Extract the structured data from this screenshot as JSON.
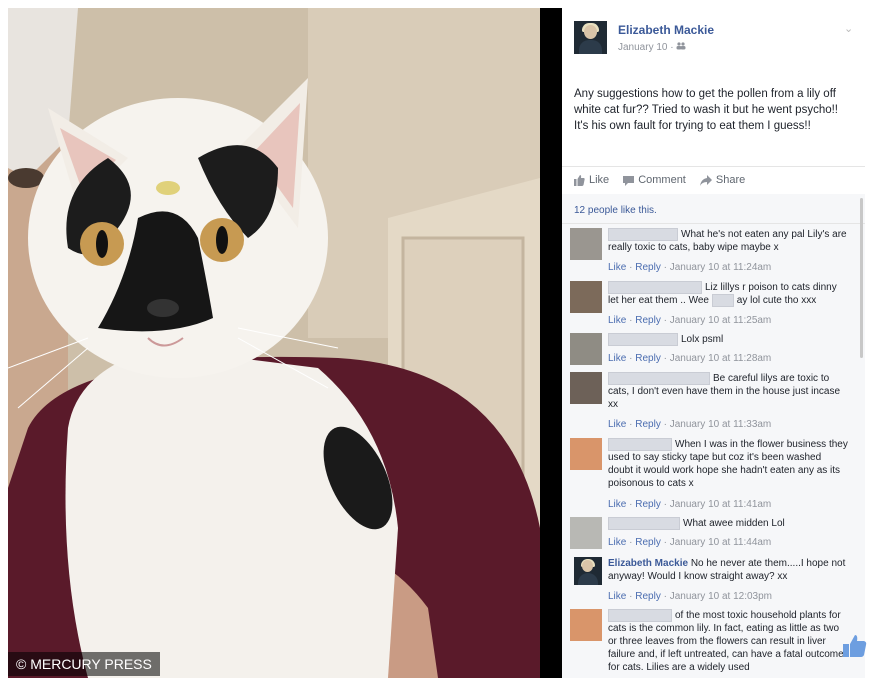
{
  "watermark": "© MERCURY PRESS",
  "post": {
    "author": "Elizabeth Mackie",
    "date": "January 10 · ",
    "audience_icon": "friends-icon",
    "text": "Any suggestions how to get the pollen from a lily off white cat fur?? Tried to wash it but he went psycho!! It's his own fault for trying to eat them I guess!!"
  },
  "actions": {
    "like": "Like",
    "comment": "Comment",
    "share": "Share"
  },
  "likes_count": "12 people like this.",
  "comments": [
    {
      "text": "What he's not eaten any pal Lily's are really toxic to cats, baby wipe maybe x",
      "meta": {
        "like": "Like",
        "reply": "Reply",
        "time": "January 10 at 11:24am"
      },
      "avatar_color": "#9a9690"
    },
    {
      "text": "Liz lillys r poison to cats dinny let her eat them .. Wee",
      "text2": "ay lol cute tho xxx",
      "meta": {
        "like": "Like",
        "reply": "Reply",
        "time": "January 10 at 11:25am"
      },
      "avatar_color": "#7c6a5a"
    },
    {
      "text": "Lolx psml",
      "meta": {
        "like": "Like",
        "reply": "Reply",
        "time": "January 10 at 11:28am"
      },
      "avatar_color": "#8f8c84"
    },
    {
      "text": "Be careful lilys are toxic to cats, I don't even have them in the house just incase xx",
      "meta": {
        "like": "Like",
        "reply": "Reply",
        "time": "January 10 at 11:33am"
      },
      "avatar_color": "#6d6158"
    },
    {
      "text": "When I was in the flower business they used to say sticky tape but coz it's been washed doubt it would work hope she hadn't eaten any as its poisonous to cats x",
      "meta": {
        "like": "Like",
        "reply": "Reply",
        "time": "January 10 at 11:41am"
      },
      "avatar_color": "#d9956a"
    },
    {
      "text": "What awee midden Lol",
      "meta": {
        "like": "Like",
        "reply": "Reply",
        "time": "January 10 at 11:44am"
      },
      "avatar_color": "#b8b8b4"
    },
    {
      "name": "Elizabeth Mackie",
      "text": "No he never ate them.....I hope not anyway! Would I know straight away? xx",
      "meta": {
        "like": "Like",
        "reply": "Reply",
        "time": "January 10 at 12:03pm"
      },
      "avatar_color": "#1f2a34"
    },
    {
      "text": "of the most toxic household plants for cats is the common lily. In fact, eating as little as two or three leaves from the flowers can result in liver failure and, if left untreated, can have a fatal outcome for cats. Lilies are a widely used",
      "avatar_color": "#d9956a"
    }
  ],
  "colors": {
    "link": "#3b5998",
    "meta": "#90949c",
    "panel_bg": "#f6f7f9"
  }
}
